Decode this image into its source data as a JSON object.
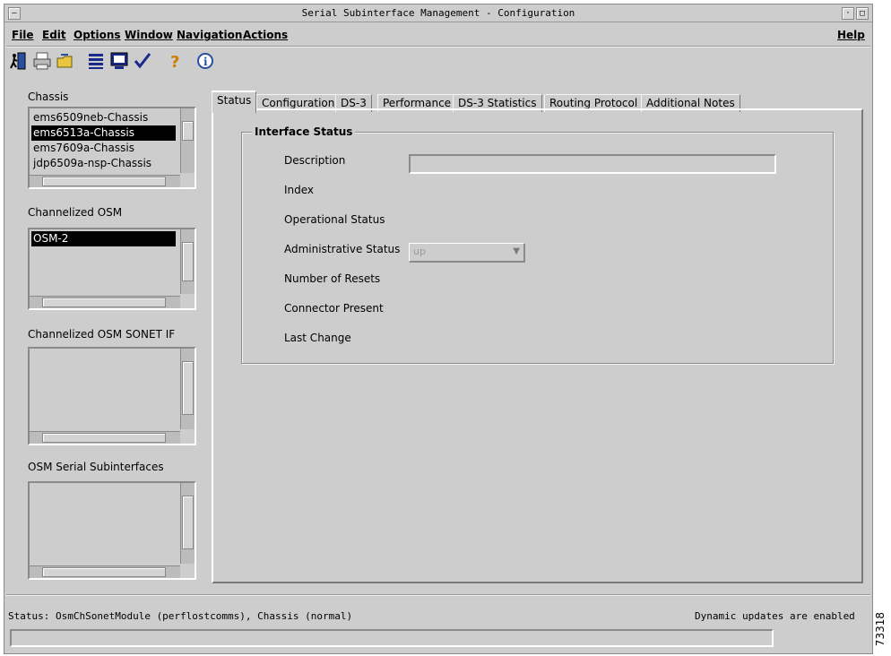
{
  "window": {
    "title": "Serial Subinterface Management - Configuration"
  },
  "menu": {
    "file": "File",
    "edit": "Edit",
    "options": "Options",
    "window": "Window",
    "navigation": "Navigation",
    "actions": "Actions",
    "help": "Help"
  },
  "toolbar": {
    "icons": [
      "exit-icon",
      "print-icon",
      "open-folder-icon",
      "list-icon",
      "monitor-icon",
      "checkmark-icon",
      "help-question-icon",
      "info-icon"
    ]
  },
  "sidebar": {
    "chassis_label": "Chassis",
    "chassis_items": [
      "ems6509neb-Chassis",
      "ems6513a-Chassis",
      "ems7609a-Chassis",
      "jdp6509a-nsp-Chassis"
    ],
    "chassis_selected": "ems6513a-Chassis",
    "osm_label": "Channelized OSM",
    "osm_items": [
      "OSM-2"
    ],
    "sonet_label": "Channelized OSM SONET IF",
    "subif_label": "OSM Serial Subinterfaces"
  },
  "tabs": [
    "Status",
    "Configuration",
    "DS-3",
    "Performance",
    "DS-3 Statistics",
    "Routing Protocol",
    "Additional Notes"
  ],
  "status_panel": {
    "group_title": "Interface Status",
    "description_label": "Description",
    "description_value": "",
    "index_label": "Index",
    "operational_status_label": "Operational Status",
    "administrative_status_label": "Administrative Status",
    "administrative_status_value": "up",
    "number_of_resets_label": "Number of Resets",
    "connector_present_label": "Connector Present",
    "last_change_label": "Last Change"
  },
  "statusbar": {
    "status_text": "Status: OsmChSonetModule (perflostcomms), Chassis (normal)",
    "updates_text": "Dynamic updates are enabled"
  },
  "figure_id": "73318"
}
